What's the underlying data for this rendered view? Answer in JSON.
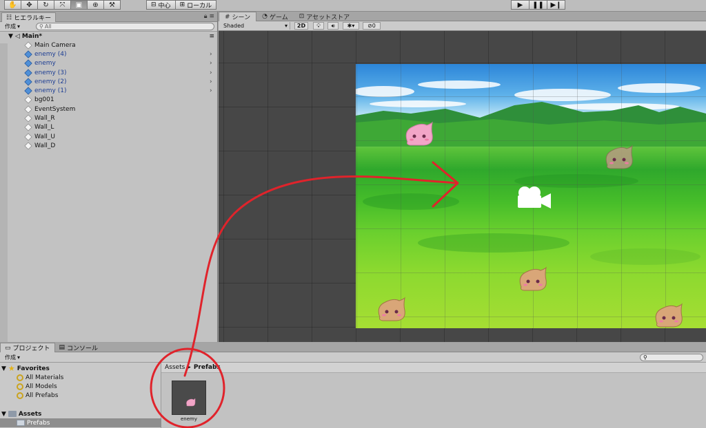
{
  "toolbar": {
    "tools": [
      "hand-icon",
      "move-icon",
      "rotate-icon",
      "scale-icon",
      "rect-icon",
      "transform-icon",
      "custom-tool-icon"
    ],
    "pivot_label": "中心",
    "local_label": "ローカル"
  },
  "hierarchy": {
    "tab_label": "ヒエラルキー",
    "create_label": "作成",
    "search_placeholder": "All",
    "scene_name": "Main*",
    "items": [
      {
        "label": "Main Camera",
        "prefab": false
      },
      {
        "label": "enemy (4)",
        "prefab": true
      },
      {
        "label": "enemy",
        "prefab": true
      },
      {
        "label": "enemy (3)",
        "prefab": true
      },
      {
        "label": "enemy (2)",
        "prefab": true
      },
      {
        "label": "enemy (1)",
        "prefab": true
      },
      {
        "label": "bg001",
        "prefab": false
      },
      {
        "label": "EventSystem",
        "prefab": false
      },
      {
        "label": "Wall_R",
        "prefab": false
      },
      {
        "label": "Wall_L",
        "prefab": false
      },
      {
        "label": "Wall_U",
        "prefab": false
      },
      {
        "label": "Wall_D",
        "prefab": false
      }
    ]
  },
  "scene": {
    "tabs": {
      "scene": "シーン",
      "game": "ゲーム",
      "store": "アセットストア"
    },
    "shading_mode": "Shaded",
    "mode_2d": "2D",
    "hidden_count": "0"
  },
  "project": {
    "tabs": {
      "project": "プロジェクト",
      "console": "コンソール"
    },
    "create_label": "作成",
    "favorites_label": "Favorites",
    "favorites": [
      "All Materials",
      "All Models",
      "All Prefabs"
    ],
    "assets_label": "Assets",
    "prefabs_folder": "Prefabs",
    "breadcrumb": {
      "root": "Assets",
      "current": "Prefabs"
    },
    "asset_name": "enemy"
  },
  "colors": {
    "annotation_red": "#e0232b",
    "prefab_blue": "#1c3d93",
    "enemy_pink": "#f2a5c7",
    "enemy_tan": "#d9a678"
  }
}
